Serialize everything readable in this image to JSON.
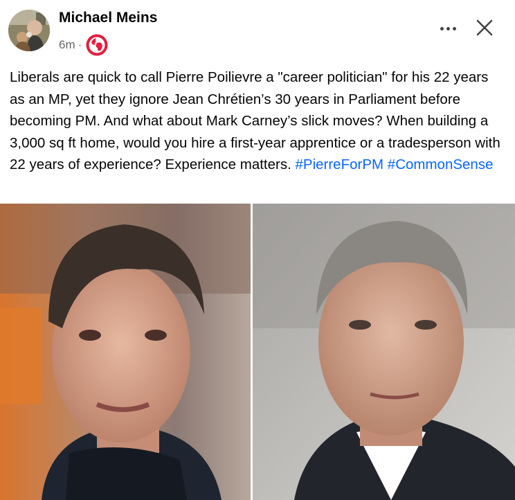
{
  "post": {
    "author_name": "Michael Meins",
    "timestamp": "6m",
    "separator": "·",
    "privacy_icon": "globe-icon",
    "more_icon": "more-options-icon",
    "close_icon": "close-icon",
    "text": "Liberals are quick to call Pierre Poilievre a \"career politician\" for his 22 years as an MP, yet they ignore Jean Chrétien’s 30 years in Parliament before becoming PM. And what about Mark Carney’s slick moves? When building a 3,000 sq ft home, would you hire a first-year apprentice or a tradesperson with 22 years of experience? Experience matters.",
    "hashtags": [
      "#PierreForPM",
      "#CommonSense"
    ]
  },
  "colors": {
    "hashtag": "#0866ff",
    "secondary_text": "#65676b",
    "privacy_icon": "#e41e3f"
  }
}
